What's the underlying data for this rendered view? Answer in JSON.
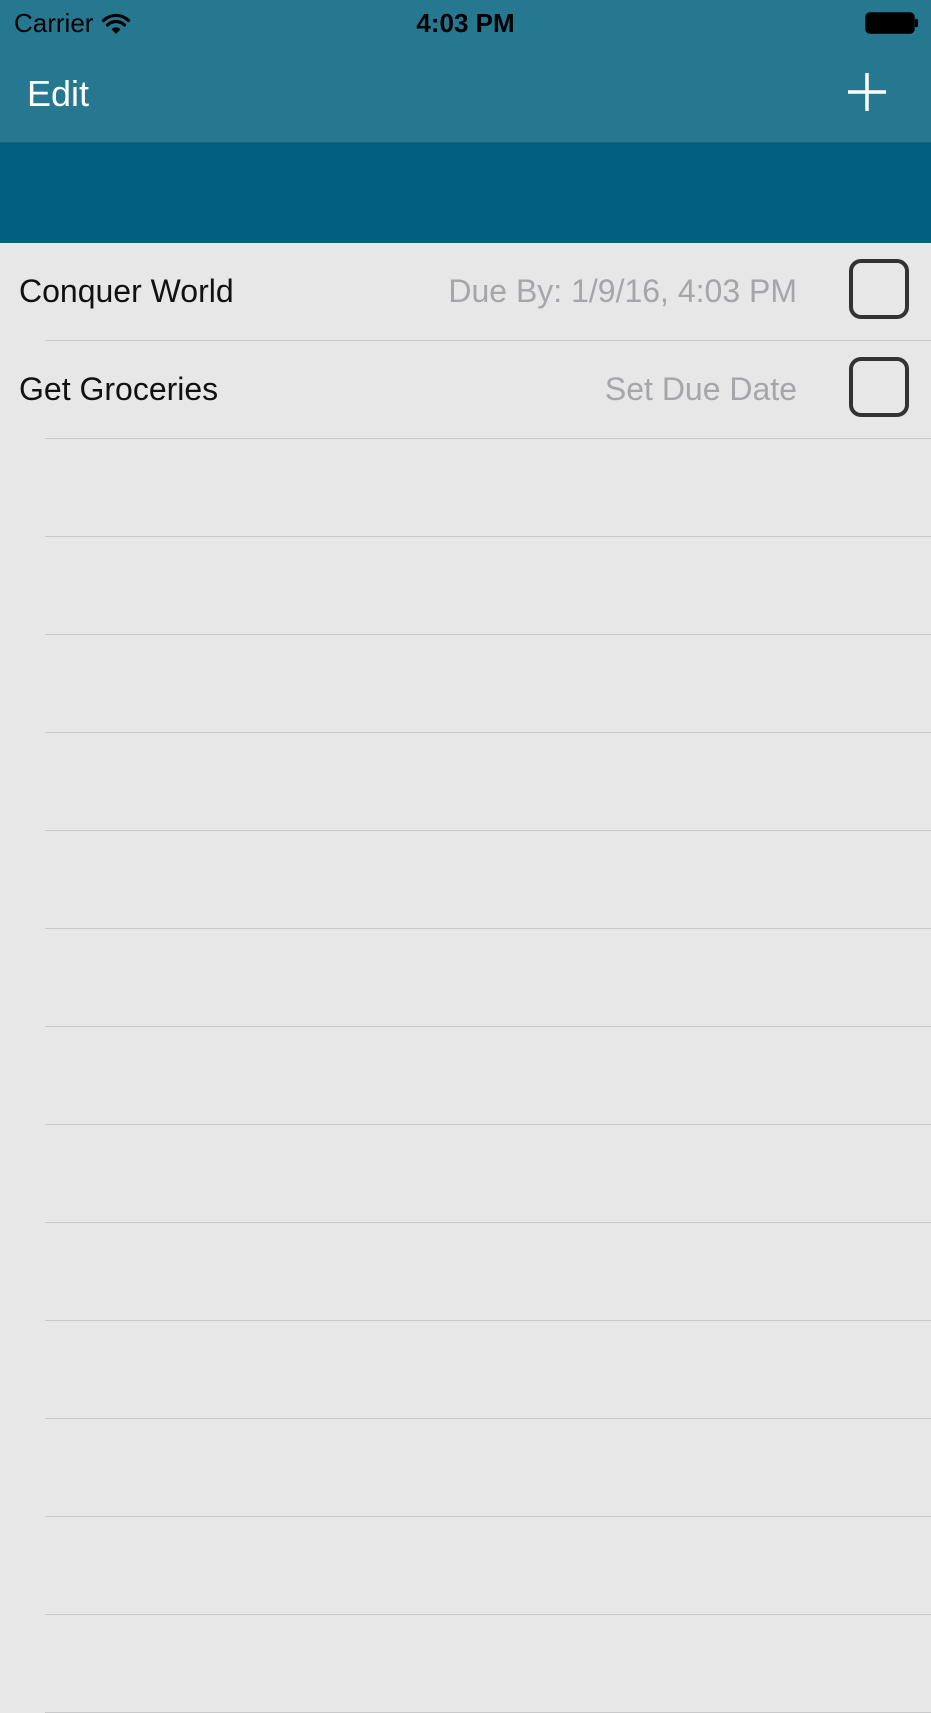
{
  "status_bar": {
    "carrier": "Carrier",
    "time": "4:03 PM",
    "wifi_icon": "wifi-icon",
    "battery_icon": "battery-full-icon"
  },
  "nav_bar": {
    "edit_label": "Edit",
    "add_icon": "plus-icon"
  },
  "colors": {
    "nav_background": "#25788f",
    "header_band": "#015f7f",
    "list_background": "#e7e7e8",
    "due_text": "#a6a6aa"
  },
  "tasks": [
    {
      "title": "Conquer World",
      "due": "Due By: 1/9/16, 4:03 PM",
      "completed": false
    },
    {
      "title": "Get Groceries",
      "due": "Set Due Date",
      "completed": false
    }
  ]
}
